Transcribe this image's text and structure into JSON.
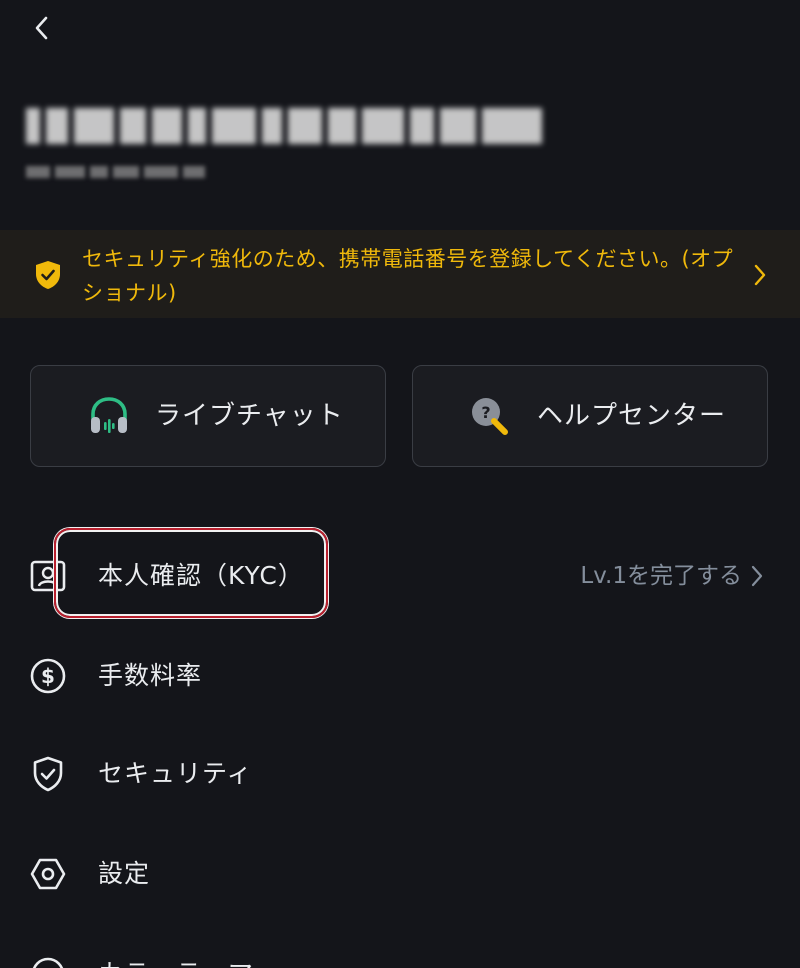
{
  "header": {
    "back_icon": "chevron-left-icon"
  },
  "security_banner": {
    "text": "セキュリティ強化のため、携帯電話番号を登録してください。(オプショナル)",
    "icon": "shield-check-icon",
    "accent_color": "#f0b90b"
  },
  "quick_actions": [
    {
      "label": "ライブチャット",
      "icon": "headset-icon"
    },
    {
      "label": "ヘルプセンター",
      "icon": "help-search-icon"
    }
  ],
  "menu": {
    "kyc": {
      "label": "本人確認（KYC）",
      "status": "Lv.1を完了する"
    },
    "fees": {
      "label": "手数料率"
    },
    "security": {
      "label": "セキュリティ"
    },
    "settings": {
      "label": "設定"
    },
    "next": {
      "label": "カラーテーマ"
    }
  },
  "colors": {
    "background": "#14151a",
    "accent": "#f0b90b",
    "highlight_outline": "#b8202e",
    "muted_text": "#848e9c"
  }
}
